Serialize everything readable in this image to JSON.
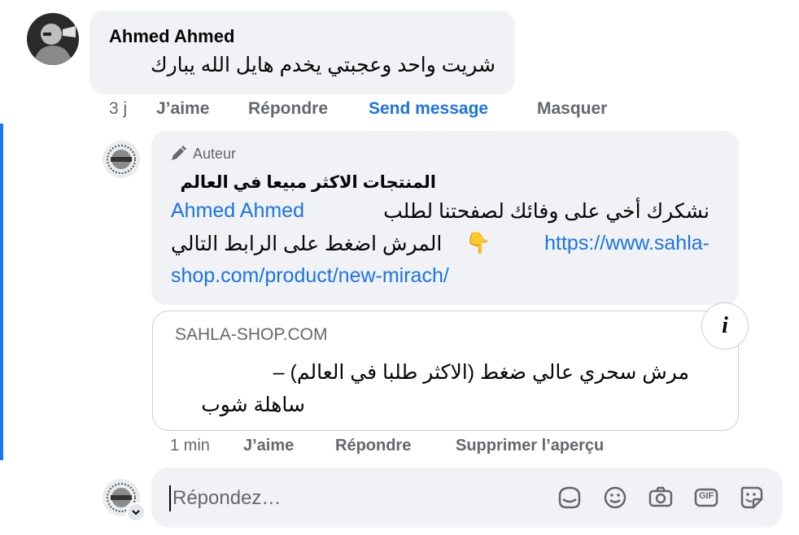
{
  "comment": {
    "author": "Ahmed Ahmed",
    "text": "شريت واحد وعجبتي يخدم هايل الله يبارك",
    "time": "3 j",
    "actions": {
      "like": "J’aime",
      "reply": "Répondre",
      "send": "Send message",
      "hide": "Masquer"
    }
  },
  "reply": {
    "badge": "Auteur",
    "author": "المنتجات الاكثر مبيعا في العالم",
    "text_part1": "نشكرك أخي على وفائك لصفحتنا لطلب",
    "mention": "Ahmed Ahmed",
    "text_part2": "المرش اضغط على الرابط التالي",
    "emoji": "👇",
    "link_line1": "https://www.sahla-",
    "link_line2": "shop.com/product/new-mirach/",
    "preview": {
      "domain": "SAHLA-SHOP.COM",
      "title_line1": "مرش سحري عالي ضغط (الاكثر طلبا في العالم) –",
      "title_line2": "ساهلة شوب",
      "info": "i"
    },
    "time": "1 min",
    "actions": {
      "like": "J’aime",
      "reply": "Répondre",
      "remove_preview": "Supprimer l’aperçu"
    }
  },
  "composer": {
    "placeholder": "Répondez…",
    "icons": [
      "sticker-icon",
      "emoji-icon",
      "camera-icon",
      "gif-icon",
      "sticker-face-icon"
    ],
    "gif_label": "GIF"
  },
  "colors": {
    "accent": "#1877f2",
    "link": "#1b74e4",
    "bubble": "#f0f2f5",
    "muted": "#65676b"
  }
}
